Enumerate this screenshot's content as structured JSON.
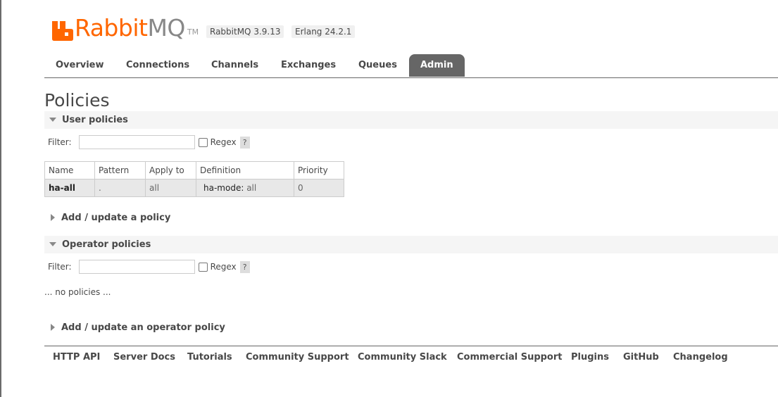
{
  "header": {
    "logo_rabbit": "Rabbit",
    "logo_mq": "MQ",
    "logo_tm": "TM",
    "version_badge": "RabbitMQ 3.9.13",
    "erlang_badge": "Erlang 24.2.1"
  },
  "nav": {
    "tabs": [
      {
        "label": "Overview",
        "active": false
      },
      {
        "label": "Connections",
        "active": false
      },
      {
        "label": "Channels",
        "active": false
      },
      {
        "label": "Exchanges",
        "active": false
      },
      {
        "label": "Queues",
        "active": false
      },
      {
        "label": "Admin",
        "active": true
      }
    ]
  },
  "page": {
    "title": "Policies"
  },
  "user_policies": {
    "section_title": "User policies",
    "filter_label": "Filter:",
    "filter_value": "",
    "regex_label": "Regex",
    "help_label": "?",
    "table": {
      "headers": [
        "Name",
        "Pattern",
        "Apply to",
        "Definition",
        "Priority"
      ],
      "rows": [
        {
          "name": "ha-all",
          "pattern": ".",
          "apply_to": "all",
          "definition_key": "ha-mode:",
          "definition_value": "all",
          "priority": "0"
        }
      ]
    },
    "add_label": "Add / update a policy"
  },
  "operator_policies": {
    "section_title": "Operator policies",
    "filter_label": "Filter:",
    "filter_value": "",
    "regex_label": "Regex",
    "help_label": "?",
    "empty_text": "... no policies ...",
    "add_label": "Add / update an operator policy"
  },
  "footer": {
    "links": [
      "HTTP API",
      "Server Docs",
      "Tutorials",
      "Community Support",
      "Community Slack",
      "Commercial Support",
      "Plugins",
      "GitHub",
      "Changelog"
    ]
  },
  "colors": {
    "brand_orange": "#ff6600",
    "active_tab": "#666666"
  }
}
